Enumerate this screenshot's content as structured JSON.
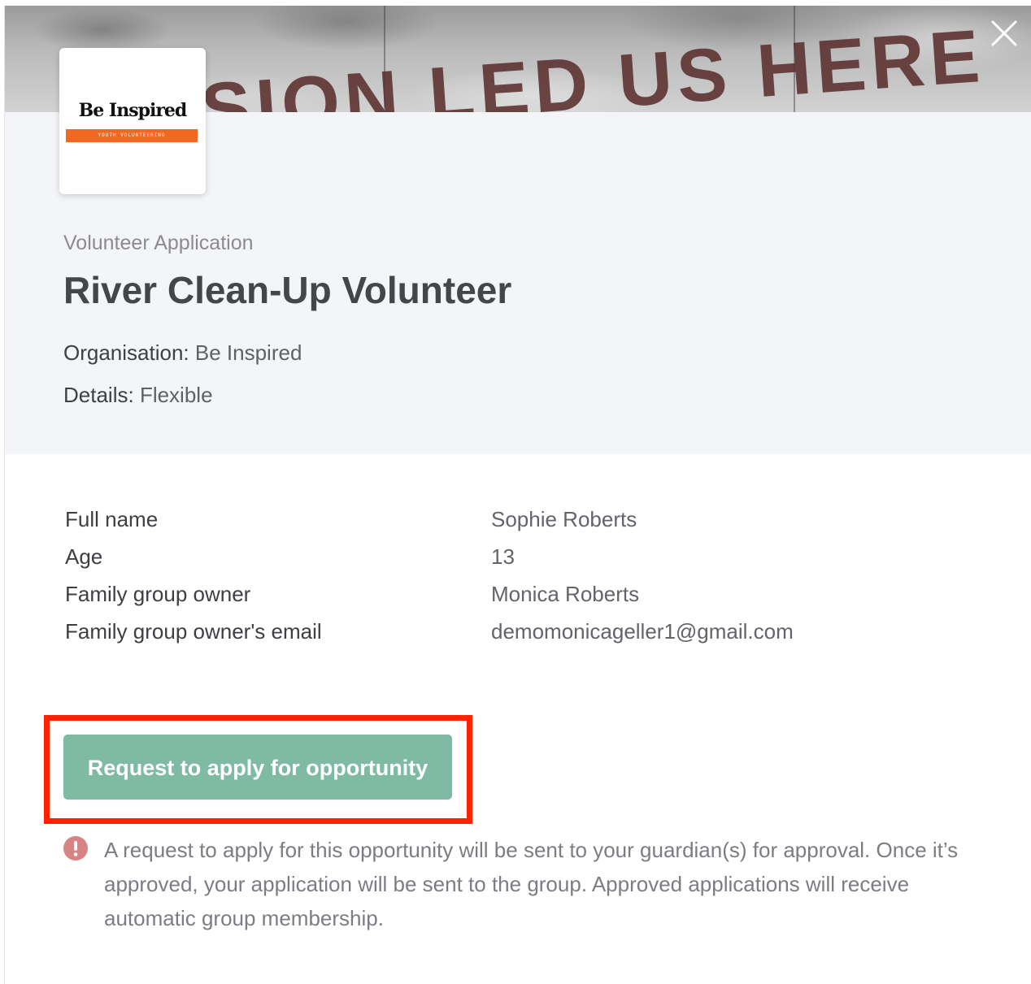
{
  "banner": {
    "image_text": "SION LED US HERE"
  },
  "logo": {
    "title": "Be Inspired",
    "tagline": "YOUTH VOLUNTEERING",
    "strip_color": "#f26722"
  },
  "header": {
    "subtitle": "Volunteer Application",
    "title": "River Clean-Up Volunteer",
    "organisation_label": "Organisation:",
    "organisation_value": "Be Inspired",
    "details_label": "Details:",
    "details_value": "Flexible"
  },
  "applicant": {
    "rows": [
      {
        "label": "Full name",
        "value": "Sophie Roberts"
      },
      {
        "label": "Age",
        "value": "13"
      },
      {
        "label": "Family group owner",
        "value": "Monica Roberts"
      },
      {
        "label": "Family group owner's email",
        "value": "demomonicageller1@gmail.com"
      }
    ]
  },
  "action": {
    "apply_label": "Request to apply for opportunity",
    "button_color": "#7fbba4",
    "highlight_color": "#ff2200"
  },
  "notice": {
    "icon": "alert-circle-icon",
    "icon_color": "#d98484",
    "text": "A request to apply for this opportunity will be sent to your guardian(s) for approval. Once it’s approved, your application will be sent to the group. Approved applications will receive automatic group membership."
  },
  "icons": {
    "close": "close-icon"
  }
}
